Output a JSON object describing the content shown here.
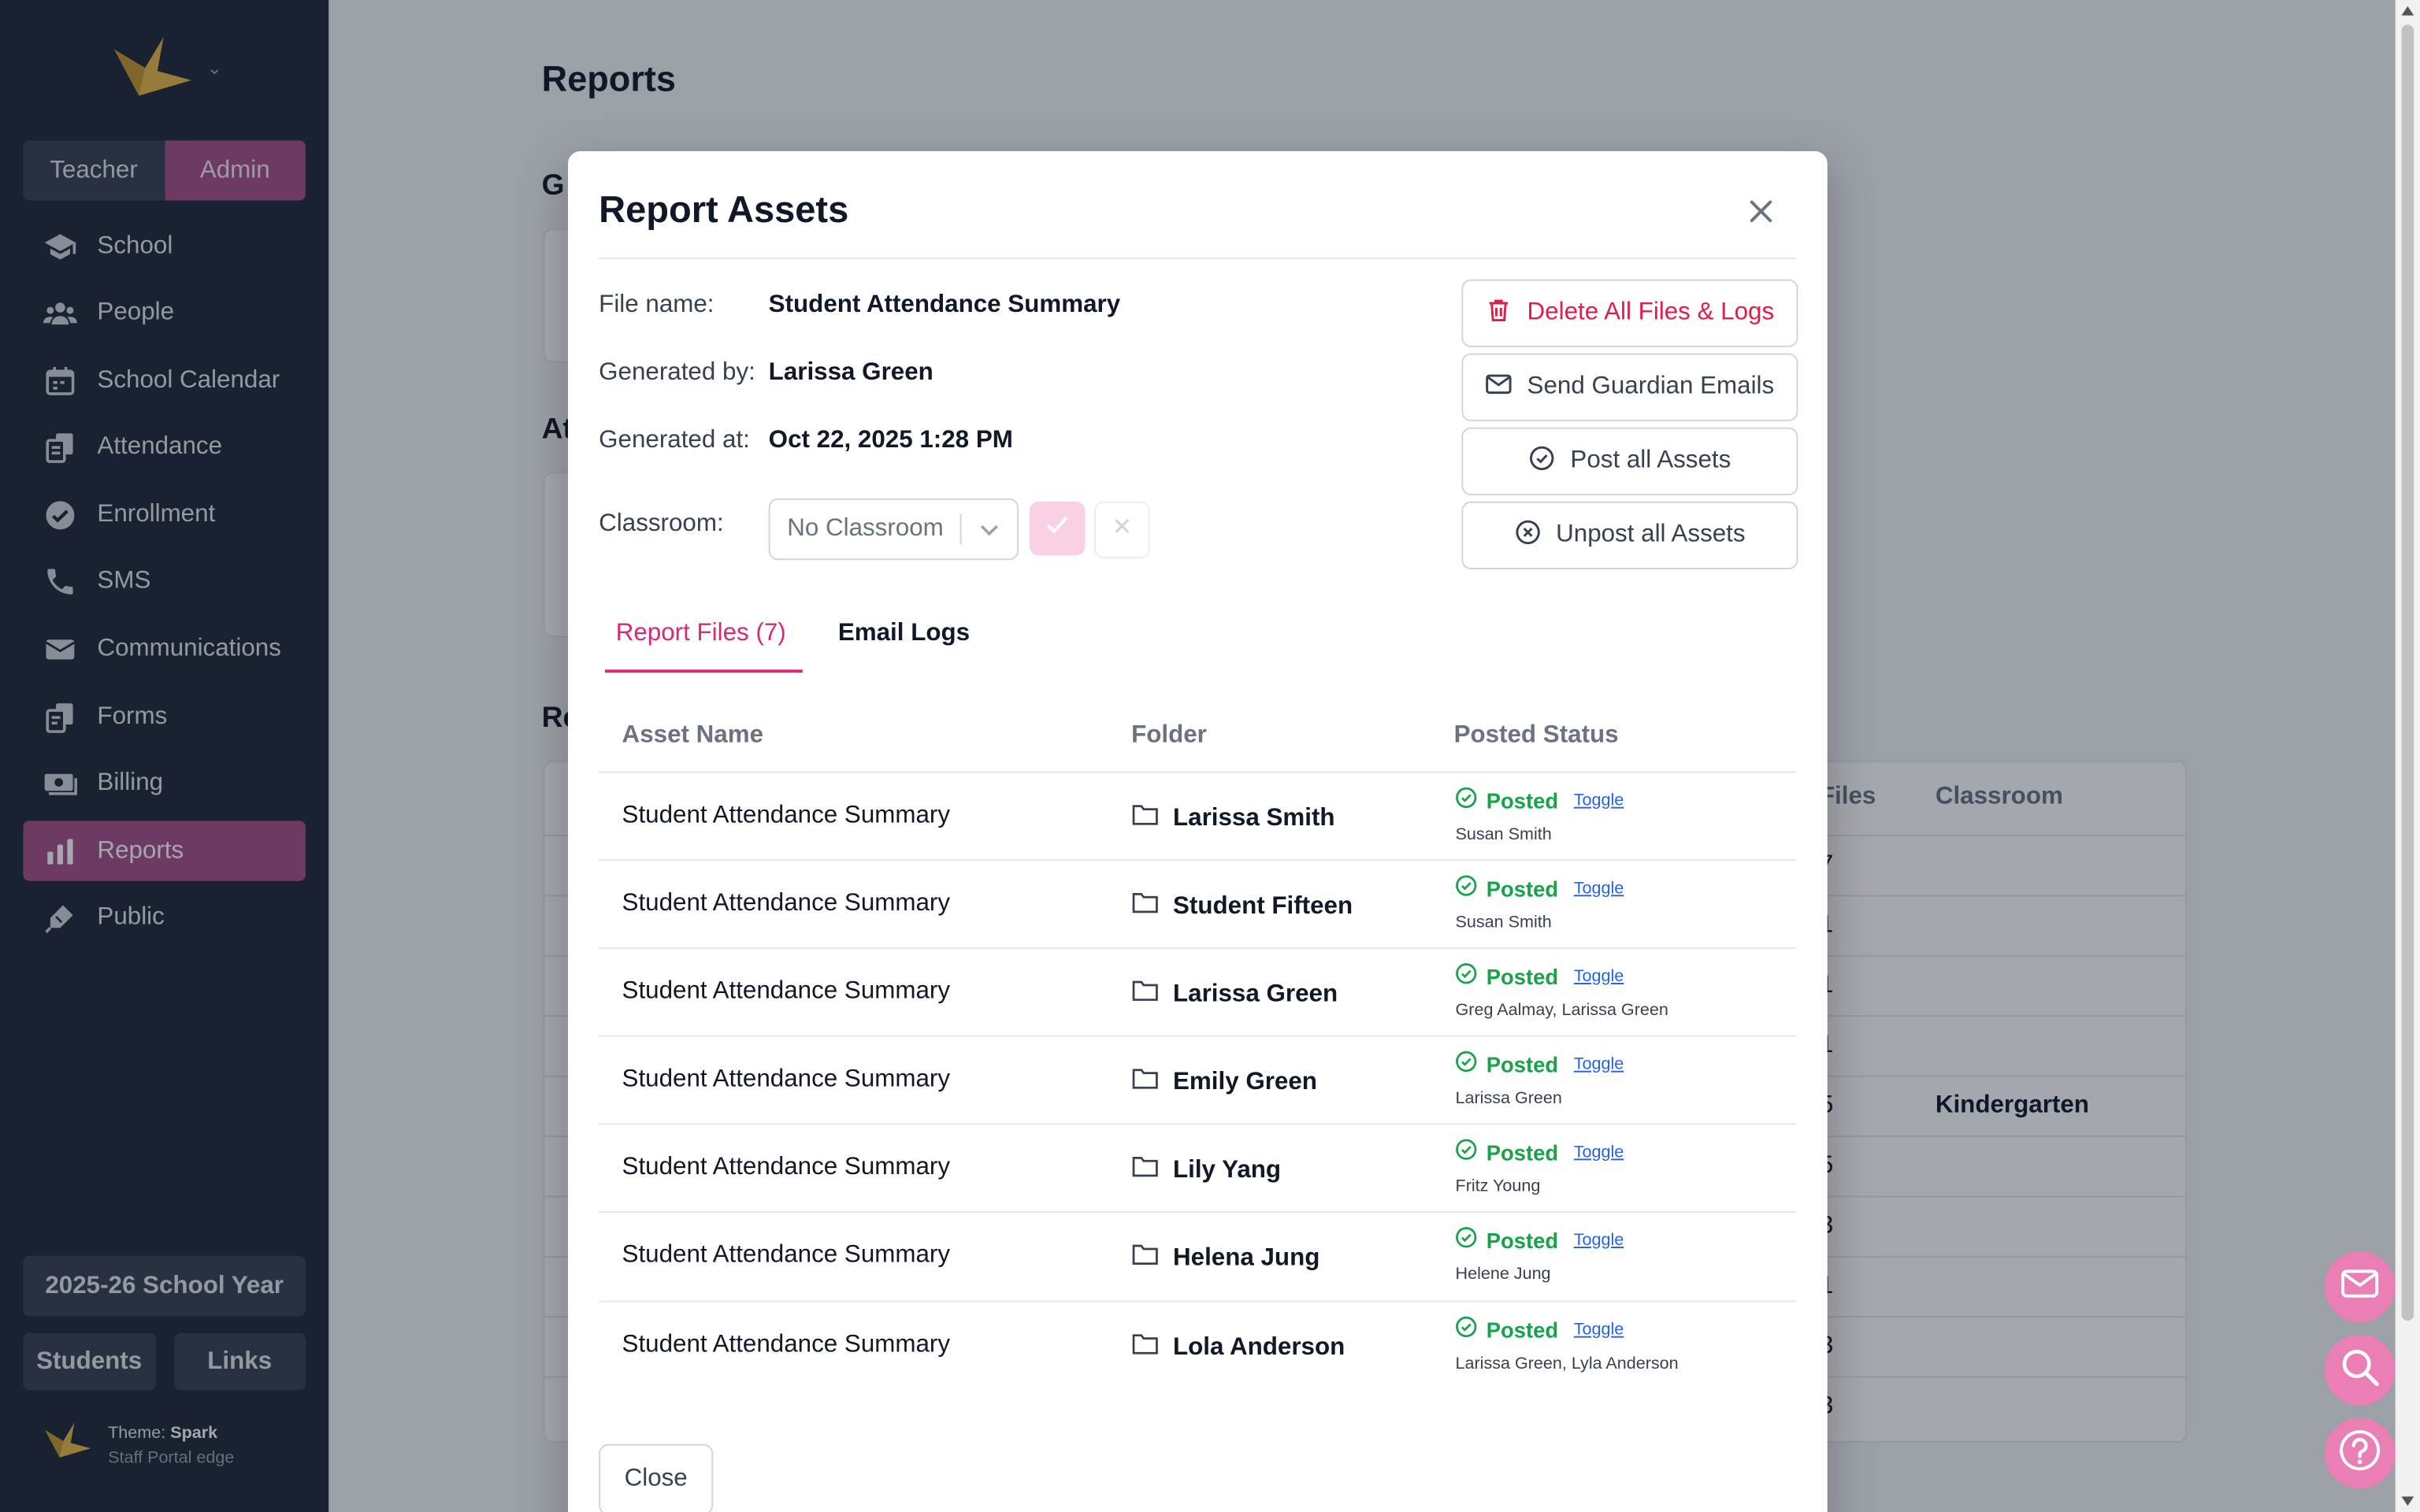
{
  "sidebar": {
    "roles": [
      "Teacher",
      "Admin"
    ],
    "nav": [
      {
        "label": "School",
        "icon": "graduation-cap-icon"
      },
      {
        "label": "People",
        "icon": "people-icon"
      },
      {
        "label": "School Calendar",
        "icon": "calendar-icon"
      },
      {
        "label": "Attendance",
        "icon": "clipboard-icon"
      },
      {
        "label": "Enrollment",
        "icon": "badge-check-icon"
      },
      {
        "label": "SMS",
        "icon": "phone-icon"
      },
      {
        "label": "Communications",
        "icon": "envelope-icon"
      },
      {
        "label": "Forms",
        "icon": "forms-icon"
      },
      {
        "label": "Billing",
        "icon": "money-icon"
      },
      {
        "label": "Reports",
        "icon": "bar-chart-icon",
        "active": true
      },
      {
        "label": "Public",
        "icon": "pen-icon"
      }
    ],
    "school_year": "2025-26 School Year",
    "students_btn": "Students",
    "links_btn": "Links",
    "theme_label": "Theme: ",
    "theme_name": "Spark",
    "theme_sub": "Staff Portal edge"
  },
  "page": {
    "title": "Reports",
    "sections": [
      "G",
      "At",
      "Re"
    ],
    "table_headers": [
      "Files",
      "Classroom"
    ],
    "table_rows": [
      {
        "files": "7",
        "classroom": ""
      },
      {
        "files": "1",
        "classroom": ""
      },
      {
        "files": "1",
        "classroom": ""
      },
      {
        "files": "1",
        "classroom": ""
      },
      {
        "files": "5",
        "classroom": "Kindergarten"
      },
      {
        "files": "5",
        "classroom": ""
      },
      {
        "files": "3",
        "classroom": ""
      },
      {
        "files": "1",
        "classroom": ""
      },
      {
        "files": "3",
        "classroom": ""
      },
      {
        "files": "3",
        "classroom": ""
      }
    ]
  },
  "modal": {
    "title": "Report Assets",
    "file_name_label": "File name:",
    "file_name": "Student Attendance Summary",
    "generated_by_label": "Generated by:",
    "generated_by": "Larissa Green",
    "generated_at_label": "Generated at:",
    "generated_at": "Oct 22, 2025 1:28 PM",
    "classroom_label": "Classroom:",
    "classroom_value": "No Classroom",
    "actions": {
      "delete": "Delete All Files & Logs",
      "send": "Send Guardian Emails",
      "post": "Post all Assets",
      "unpost": "Unpost all Assets"
    },
    "tabs": {
      "files": "Report Files (7)",
      "logs": "Email Logs"
    },
    "columns": {
      "asset": "Asset Name",
      "folder": "Folder",
      "status": "Posted Status"
    },
    "rows": [
      {
        "asset": "Student Attendance Summary",
        "folder": "Larissa Smith",
        "status": "Posted",
        "toggle": "Toggle",
        "who": "Susan Smith"
      },
      {
        "asset": "Student Attendance Summary",
        "folder": "Student Fifteen",
        "status": "Posted",
        "toggle": "Toggle",
        "who": "Susan Smith"
      },
      {
        "asset": "Student Attendance Summary",
        "folder": "Larissa Green",
        "status": "Posted",
        "toggle": "Toggle",
        "who": "Greg Aalmay, Larissa Green"
      },
      {
        "asset": "Student Attendance Summary",
        "folder": "Emily Green",
        "status": "Posted",
        "toggle": "Toggle",
        "who": "Larissa Green"
      },
      {
        "asset": "Student Attendance Summary",
        "folder": "Lily Yang",
        "status": "Posted",
        "toggle": "Toggle",
        "who": "Fritz Young"
      },
      {
        "asset": "Student Attendance Summary",
        "folder": "Helena Jung",
        "status": "Posted",
        "toggle": "Toggle",
        "who": "Helene Jung"
      },
      {
        "asset": "Student Attendance Summary",
        "folder": "Lola Anderson",
        "status": "Posted",
        "toggle": "Toggle",
        "who": "Larissa Green, Lyla Anderson"
      }
    ],
    "close": "Close"
  },
  "colors": {
    "sidebar_bg": "#1f2937",
    "accent": "#a54f86",
    "tab_accent": "#db2777",
    "posted_green": "#16a34a",
    "danger": "#e11d48",
    "fab": "#ea7fb6"
  }
}
